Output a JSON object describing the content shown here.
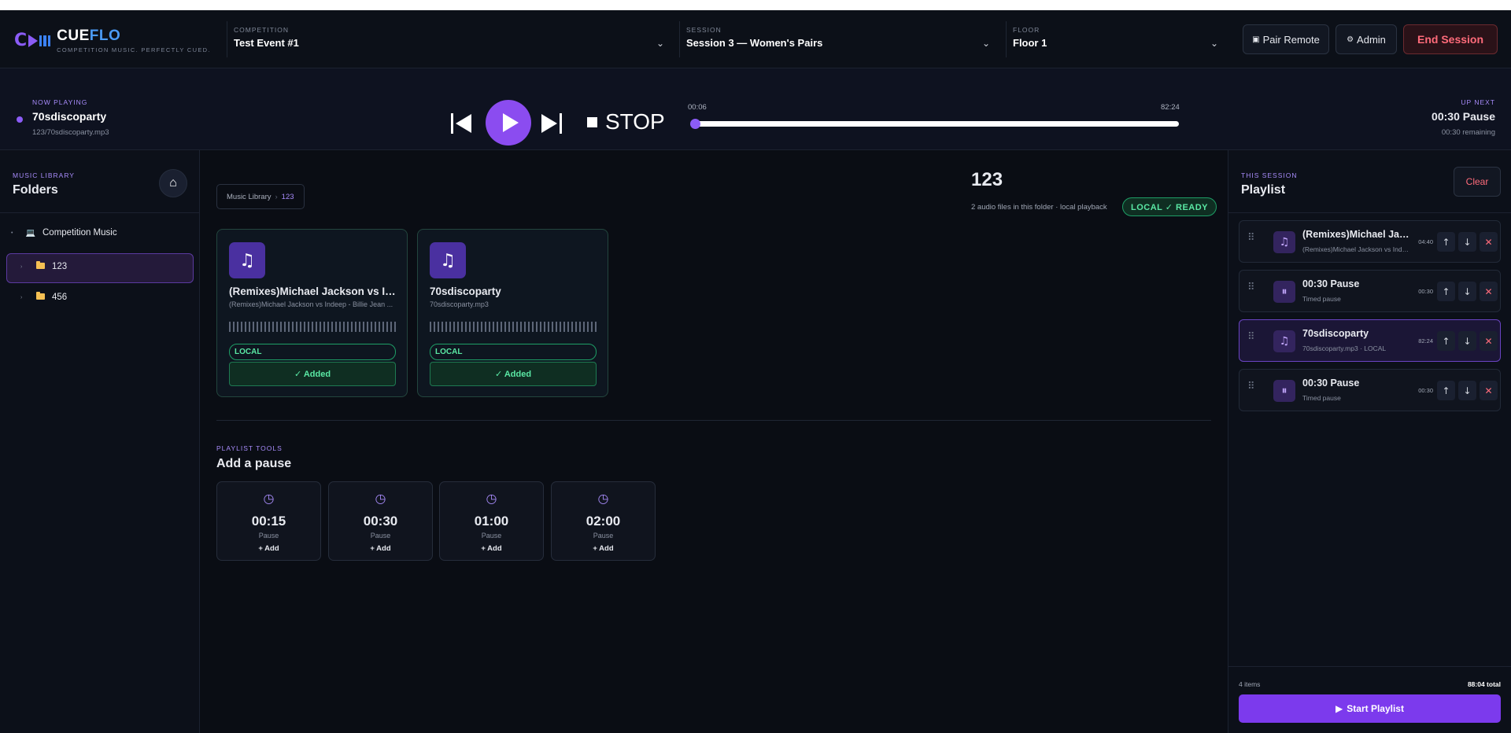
{
  "app": {
    "name_a": "CUE",
    "name_b": "FLO",
    "tagline": "COMPETITION MUSIC. PERFECTLY CUED."
  },
  "header": {
    "competition_label": "COMPETITION",
    "competition_value": "Test Event #1",
    "session_label": "SESSION",
    "session_value": "Session 3 — Women's Pairs",
    "floor_label": "FLOOR",
    "floor_value": "Floor 1",
    "pair_remote": "Pair Remote",
    "admin": "Admin",
    "end_session": "End Session"
  },
  "now_playing": {
    "label": "NOW PLAYING",
    "title": "70sdiscoparty",
    "path": "123/70sdiscoparty.mp3",
    "current_time": "00:06",
    "total_time": "82:24",
    "progress": 0.0012,
    "stop_label": "STOP"
  },
  "up_next": {
    "label": "UP NEXT",
    "title": "00:30 Pause",
    "remaining": "00:30 remaining"
  },
  "library": {
    "label": "MUSIC LIBRARY",
    "title": "Folders",
    "tree": [
      {
        "label": "Competition Music"
      },
      {
        "label": "123"
      },
      {
        "label": "456"
      }
    ]
  },
  "folder": {
    "crumb_root": "Music Library",
    "crumb_sep": "›",
    "crumb_current": "123",
    "title": "123",
    "subtitle": "2 audio files in this folder · local playback",
    "ready_badge": "LOCAL ✓ READY",
    "tracks": [
      {
        "title": "(Remixes)Michael Jackson vs Indeep - Billie Jean ...",
        "file": "(Remixes)Michael Jackson vs Indeep - Billie Jean ...",
        "badge": "LOCAL",
        "status": "✓ Added"
      },
      {
        "title": "70sdiscoparty",
        "file": "70sdiscoparty.mp3",
        "badge": "LOCAL",
        "status": "✓ Added"
      }
    ]
  },
  "tools": {
    "label": "PLAYLIST TOOLS",
    "title": "Add a pause",
    "pauses": [
      {
        "duration": "00:15",
        "label": "Pause",
        "add": "+ Add"
      },
      {
        "duration": "00:30",
        "label": "Pause",
        "add": "+ Add"
      },
      {
        "duration": "01:00",
        "label": "Pause",
        "add": "+ Add"
      },
      {
        "duration": "02:00",
        "label": "Pause",
        "add": "+ Add"
      }
    ]
  },
  "playlist": {
    "label": "THIS SESSION",
    "title": "Playlist",
    "clear": "Clear",
    "items": [
      {
        "title": "(Remixes)Michael Jackson vs Indeep - Billie Jean",
        "sub": "(Remixes)Michael Jackson vs Indeep - Billie Jean",
        "duration": "04:40",
        "kind": "track"
      },
      {
        "title": "00:30 Pause",
        "sub": "Timed pause",
        "duration": "00:30",
        "kind": "pause"
      },
      {
        "title": "70sdiscoparty",
        "sub": "70sdiscoparty.mp3 · LOCAL",
        "duration": "82:24",
        "kind": "track"
      },
      {
        "title": "00:30 Pause",
        "sub": "Timed pause",
        "duration": "00:30",
        "kind": "pause"
      }
    ],
    "count": "4 items",
    "total": "88:04 total",
    "start": "Start Playlist"
  },
  "colors": {
    "accent": "#8b5cf6",
    "local_green": "#5ae8a4",
    "danger": "#ff6b7a",
    "brand_blue": "#4b9bf6"
  }
}
